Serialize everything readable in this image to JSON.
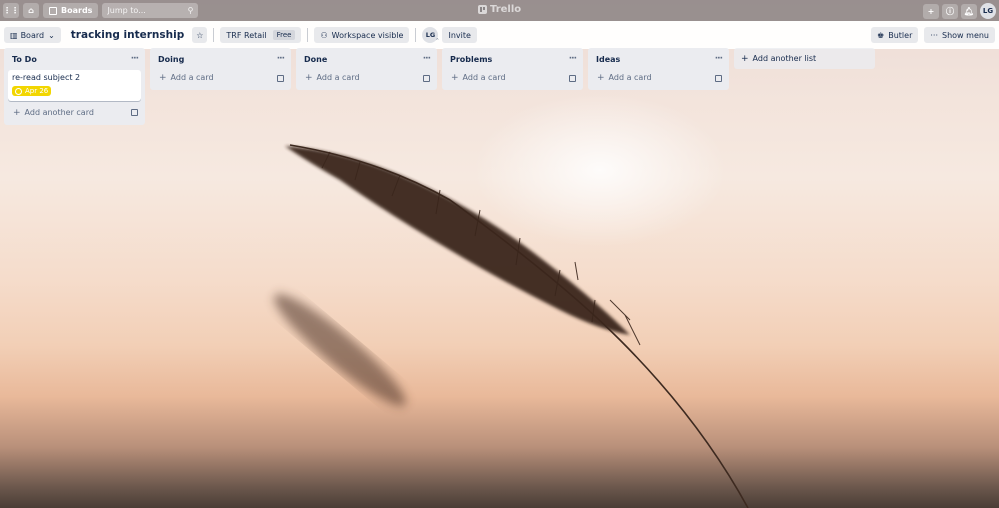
{
  "topbar": {
    "boards_label": "Boards",
    "search_placeholder": "Jump to...",
    "logo_text": "Trello",
    "user_initials": "LG"
  },
  "board_header": {
    "view_label": "Board",
    "title": "tracking internship",
    "workspace_label": "TRF Retail",
    "workspace_badge": "Free",
    "visibility_label": "Workspace visible",
    "member_initials": "LG",
    "invite_label": "Invite",
    "butler_label": "Butler",
    "menu_label": "Show menu"
  },
  "lists": [
    {
      "title": "To Do",
      "cards": [
        {
          "title": "re-read subject 2",
          "due": "Apr 26",
          "due_color": "#f2d600"
        }
      ],
      "add_label": "Add another card"
    },
    {
      "title": "Doing",
      "cards": [],
      "add_label": "Add a card"
    },
    {
      "title": "Done",
      "cards": [],
      "add_label": "Add a card"
    },
    {
      "title": "Problems",
      "cards": [],
      "add_label": "Add a card"
    },
    {
      "title": "Ideas",
      "cards": [],
      "add_label": "Add a card"
    }
  ],
  "add_list_label": "Add another list"
}
